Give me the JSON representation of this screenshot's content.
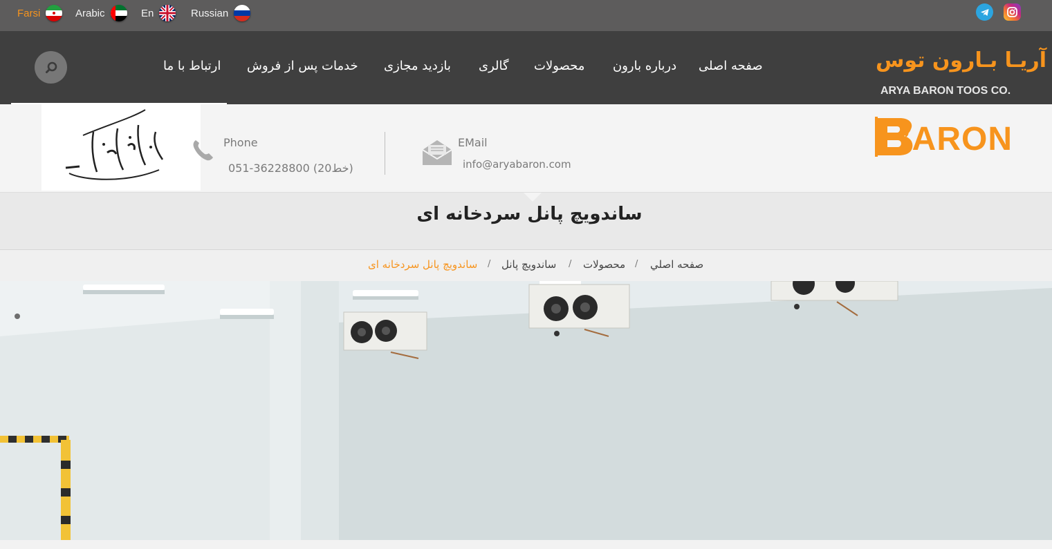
{
  "languages": [
    {
      "label": "Farsi",
      "active": true,
      "flag": "iran-flag-icon"
    },
    {
      "label": "Arabic",
      "active": false,
      "flag": "uae-flag-icon"
    },
    {
      "label": "En",
      "active": false,
      "flag": "uk-flag-icon"
    },
    {
      "label": "Russian",
      "active": false,
      "flag": "russia-flag-icon"
    }
  ],
  "social": [
    "telegram-icon",
    "instagram-icon"
  ],
  "logo": {
    "fa": "آریـا بـارون توس",
    "en": "ARYA BARON TOOS CO."
  },
  "nav": {
    "home": "صفحه اصلی",
    "about": "درباره بارون",
    "products": "محصولات",
    "gallery": "گالری",
    "virtual_tour": "بازدید مجازی",
    "after_sales": "خدمات پس از فروش",
    "contact": "ارتباط با ما"
  },
  "contact": {
    "phone_label": "Phone",
    "phone_value": "051-36228800 (20خط)",
    "email_label": "EMail",
    "email_value": "info@aryabaron.com"
  },
  "brand_logo": "BARON",
  "calligraphy": "پایدار و نیک ماندگار و شیک",
  "page_title": "ساندویچ پانل سردخانه ای",
  "breadcrumb": {
    "home": "صفحه اصلي",
    "products": "محصولات",
    "sandwich": "ساندويچ پانل",
    "current": "ساندویچ پانل سردخانه ای"
  },
  "colors": {
    "accent": "#f7941d",
    "nav_bg": "#3f3f3f",
    "topbar_bg": "#5d5c5c"
  }
}
